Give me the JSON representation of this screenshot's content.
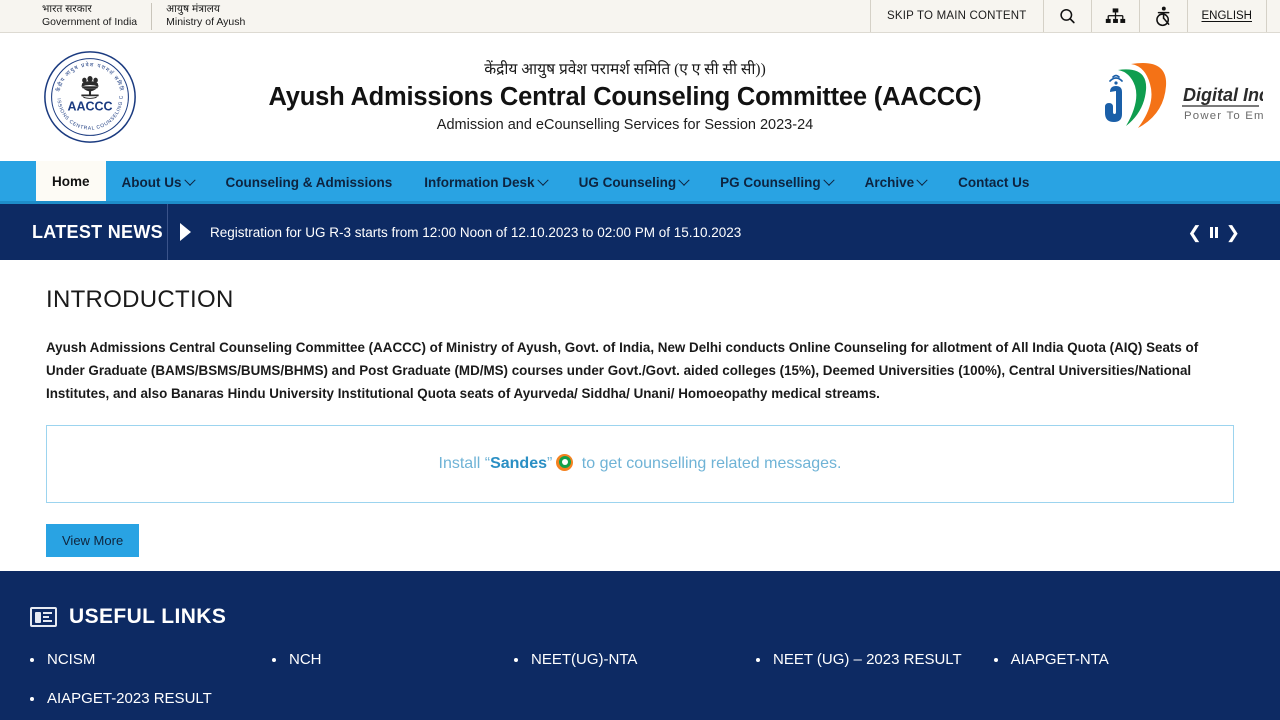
{
  "topbar": {
    "gov": [
      {
        "hindi": "भारत सरकार",
        "english": "Government of India"
      },
      {
        "hindi": "आयुष मंत्रालय",
        "english": "Ministry of Ayush"
      }
    ],
    "skip_label": "SKIP TO MAIN CONTENT",
    "search_icon": "search-icon",
    "sitemap_icon": "sitemap-icon",
    "accessibility_icon": "accessibility-icon",
    "language_label": "ENGLISH"
  },
  "masthead": {
    "logo_left_text": "AACCC",
    "hindi_title": "केंद्रीय आयुष प्रवेश परामर्श समिति (ए ए सी सी सी))",
    "title": "Ayush Admissions Central Counseling Committee (AACCC)",
    "subtitle": "Admission and eCounselling Services for Session 2023-24",
    "digital_india_title": "Digital India",
    "digital_india_tagline": "Power To Empower"
  },
  "nav": {
    "items": [
      {
        "label": "Home",
        "caret": false,
        "active": true
      },
      {
        "label": "About Us",
        "caret": true,
        "active": false
      },
      {
        "label": "Counseling & Admissions",
        "caret": false,
        "active": false
      },
      {
        "label": "Information Desk",
        "caret": true,
        "active": false
      },
      {
        "label": "UG Counseling",
        "caret": true,
        "active": false
      },
      {
        "label": "PG Counselling",
        "caret": true,
        "active": false
      },
      {
        "label": "Archive",
        "caret": true,
        "active": false
      },
      {
        "label": "Contact Us",
        "caret": false,
        "active": false
      }
    ]
  },
  "news": {
    "label": "LATEST NEWS",
    "text": "Registration for UG R-3 starts from 12:00 Noon of 12.10.2023 to 02:00 PM of 15.10.2023",
    "prev": "❮",
    "next": "❯"
  },
  "main": {
    "section_title": "INTRODUCTION",
    "intro": "Ayush Admissions Central Counseling Committee (AACCC) of Ministry of Ayush, Govt. of India, New Delhi conducts Online Counseling for allotment of All India Quota (AIQ) Seats of Under Graduate (BAMS/BSMS/BUMS/BHMS) and Post Graduate (MD/MS) courses under Govt./Govt. aided colleges (15%), Deemed Universities (100%), Central Universities/National Institutes, and also Banaras Hindu University Institutional Quota seats of Ayurveda/ Siddha/ Unani/ Homoeopathy medical streams.",
    "sandes_prefix": "Install “",
    "sandes_name": "Sandes",
    "sandes_suffix": "”",
    "sandes_rest": " to get counselling related messages.",
    "view_more_label": "View More"
  },
  "footer": {
    "title": "USEFUL LINKS",
    "icon": "id-card-icon",
    "links_row1": [
      "NCISM",
      "NCH",
      "NEET(UG)-NTA",
      "NEET (UG) – 2023 RESULT",
      "AIAPGET-NTA"
    ],
    "links_row2": [
      "AIAPGET-2023 RESULT"
    ]
  },
  "colors": {
    "nav_blue": "#29a3e3",
    "dark_blue": "#0d2a63",
    "topbar_bg": "#f7f5f0",
    "sandes_text": "#6fb3d6",
    "sandes_border": "#9cd4ef"
  }
}
